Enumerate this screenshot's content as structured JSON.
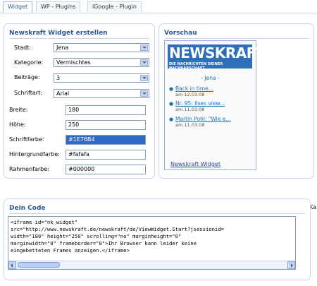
{
  "tabs": [
    {
      "label": "Widget",
      "active": true
    },
    {
      "label": "WP - Plugins",
      "active": false
    },
    {
      "label": "iGoogle - Plugin",
      "active": false
    }
  ],
  "widget_panel": {
    "title": "Newskraft Widget erstellen",
    "fields": {
      "stadt": {
        "label": "Stadt:",
        "value": "Jena"
      },
      "kategorie": {
        "label": "Kategorie:",
        "value": "Vermischtes"
      },
      "beitraege": {
        "label": "Beiträge:",
        "value": "3"
      },
      "schriftart": {
        "label": "Schriftart:",
        "value": "Arial"
      },
      "breite": {
        "label": "Breite:",
        "value": "180"
      },
      "hoehe": {
        "label": "Höhe:",
        "value": "250"
      },
      "schriftfarbe": {
        "label": "Schriftfarbe:",
        "value": "#1E76B4"
      },
      "hintergrundfarbe": {
        "label": "Hintergrundfarbe:",
        "value": "#fafafa"
      },
      "rahmenfarbe": {
        "label": "Rahmenfarbe:",
        "value": "#000000"
      }
    }
  },
  "preview_panel": {
    "title": "Vorschau",
    "logo_name": "NEWSKRAFT",
    "logo_tagline": "DIE NACHRICHTEN DEINER NACHBARSCHAFT.",
    "city_heading": "- Jena -",
    "news": [
      {
        "title": "Back in time...",
        "date": "am 12.03.08"
      },
      {
        "title": "Nr. 95: Ilses view...",
        "date": "am 11.03.08"
      },
      {
        "title": "Martin Pohl: \"Wie e...",
        "date": "am 11.03.08"
      }
    ],
    "footer_link": "Newskraft Widget"
  },
  "code_panel": {
    "title": "Dein Code",
    "lines": [
      "<iframe id=\"nk_widget\"",
      "src=\"http://www.newskraft.de/newskraft/de/ViewWidget.Start?jsessionid=",
      "width=\"180\" height=\"250\" scrolling=\"no\" marginheight=\"0\"",
      "marginwidth=\"0\" frameborder=\"0\">Ihr Browser kann leider keine",
      "eingebetteten Frames anzeigen.</iframe>"
    ]
  },
  "side_text": "Ka",
  "colors": {
    "accent": "#2b5a9a",
    "link": "#1e76b4",
    "logo_bg": "#2e6fb8",
    "panel_border": "#c9d7ea"
  }
}
